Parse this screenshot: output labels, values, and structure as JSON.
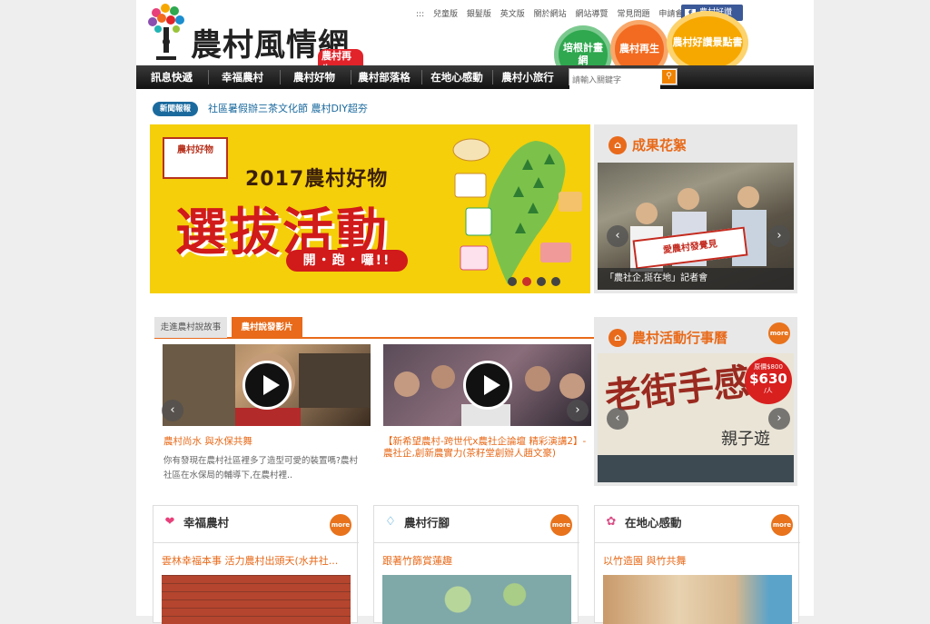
{
  "site": {
    "title": "農村風情網",
    "subtitle": "農村再生"
  },
  "toplinks": [
    "兒童版",
    "銀髮版",
    "英文版",
    "關於網站",
    "網站導覽",
    "常見問題",
    "申請會員"
  ],
  "facebook": {
    "label": "農村好讚",
    "icon": "facebook-icon"
  },
  "circles": [
    "培根計畫網",
    "農村再生",
    "農村好讚景點書"
  ],
  "nav": {
    "items": [
      "訊息快遞",
      "幸福農村",
      "農村好物",
      "農村部落格",
      "在地心感動",
      "農村小旅行"
    ],
    "search_placeholder": "請輸入關鍵字"
  },
  "news": {
    "badge": "新聞報報",
    "headline": "社區暑假辦三茶文化節 農村DIY超夯"
  },
  "banner": {
    "logo_text": "農村好物",
    "year_line": "2017農村好物",
    "big_text": "選拔活動",
    "pill_text": "開・跑・囉!!",
    "slide_count": 4,
    "active_slide": 2
  },
  "results": {
    "heading": "成果花絮",
    "photo_sign": "愛農村發覺見",
    "caption": "「農社企,挺在地」記者會"
  },
  "video_tabs": {
    "tab1": "走進農村說故事",
    "tab2": "農村說發影片"
  },
  "videos": [
    {
      "title": "農村尚水 與水保共舞",
      "desc": "你有發現在農村社區裡多了造型可愛的裝置嗎?農村社區在水保局的輔導下,在農村裡.."
    },
    {
      "title": "【新希望農村-跨世代x農社企論壇 精彩演講2】-農社企,創新農實力(茶籽堂創辦人趙文豪)",
      "desc": ""
    }
  ],
  "calendar": {
    "heading": "農村活動行事曆",
    "more": "more",
    "poster_title": "老街手感",
    "poster_sub": "親子遊",
    "badge_top": "原價$800",
    "badge_price": "$630",
    "badge_unit": "/人"
  },
  "cards": [
    {
      "heading": "幸福農村",
      "icon": "hearts-icon",
      "title": "雲林幸福本事 活力農村出頭天(水井社..."
    },
    {
      "heading": "農村行腳",
      "icon": "shoes-icon",
      "title": "跟著竹篩賞蓮趣"
    },
    {
      "heading": "在地心感動",
      "icon": "gift-icon",
      "title": "以竹造園 與竹共舞"
    }
  ],
  "more_label": "more"
}
